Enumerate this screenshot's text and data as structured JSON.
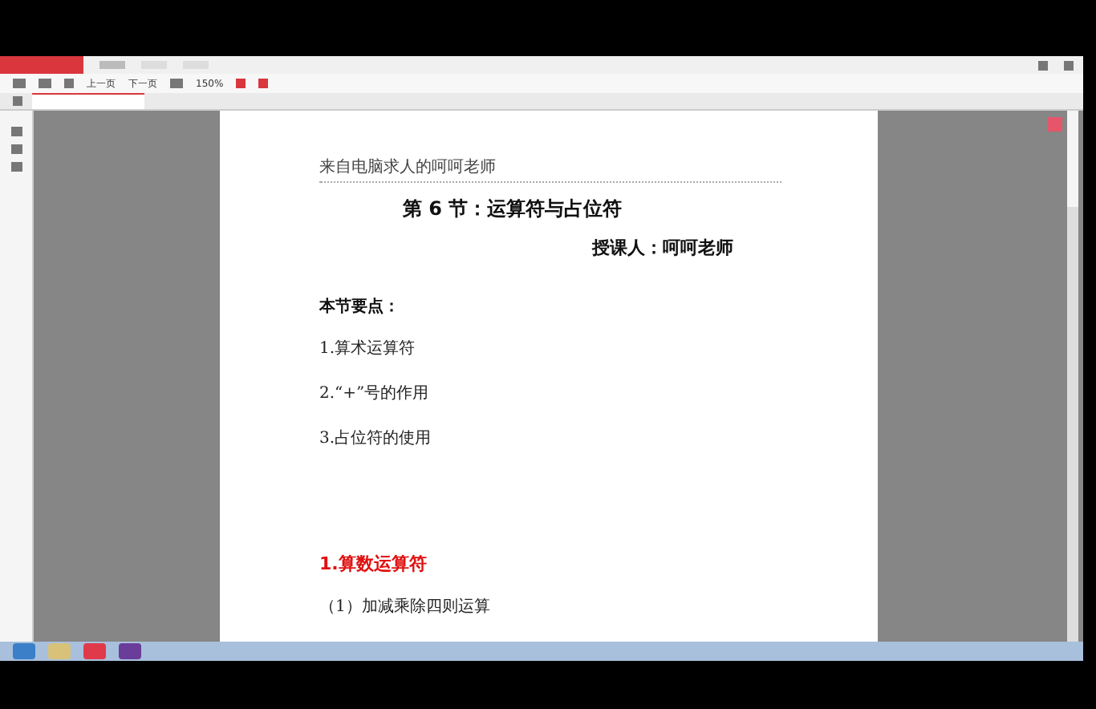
{
  "ribbon_tabs": [
    {
      "selected": true
    },
    {
      "selected": false
    },
    {
      "selected": false
    }
  ],
  "toolbar": {
    "prev_page": "上一页",
    "next_page": "下一页",
    "zoom": "150%"
  },
  "document": {
    "header": "来自电脑求人的呵呵老师",
    "title": "第 6 节：运算符与占位符",
    "lecturer": "授课人：呵呵老师",
    "section_heading": "本节要点：",
    "points": [
      "1.算术运算符",
      "2.“+”号的作用",
      "3.占位符的使用"
    ],
    "subheading": "1.算数运算符",
    "subitem": "（1）加减乘除四则运算"
  }
}
